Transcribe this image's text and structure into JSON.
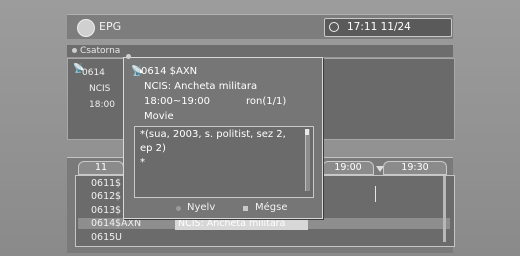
{
  "header": {
    "title": "EPG",
    "datetime": "17:11 11/24"
  },
  "channel_bar": {
    "label": "Csatorna"
  },
  "left_panel": {
    "satellite_icon": "satellite-icon",
    "channel_number": "0614",
    "program": "NCIS",
    "time": "18:00"
  },
  "info_popup": {
    "channel": "0614 $AXN",
    "program": "NCIS: Ancheta militara",
    "time": "18:00~19:00",
    "language": "ron(1/1)",
    "genre": "Movie",
    "description": "*(sua, 2003, s. politist, sez 2,\nep 2)\n*",
    "buttons": {
      "language": "Nyelv",
      "cancel": "Mégse"
    }
  },
  "timeline": {
    "left_label": "11",
    "times": [
      "19:00",
      "19:30"
    ]
  },
  "channel_list": [
    {
      "num": "0611",
      "name": "$"
    },
    {
      "num": "0612",
      "name": "$"
    },
    {
      "num": "0613",
      "name": "$"
    },
    {
      "num": "0614",
      "name": "$AXN",
      "program": "NCIS: Ancheta militara",
      "selected": true
    },
    {
      "num": "0615",
      "name": "U"
    }
  ],
  "colors": {
    "background": "#9c9c9c",
    "panel": "#6b6b6b",
    "highlight": "#d7d7d7"
  }
}
